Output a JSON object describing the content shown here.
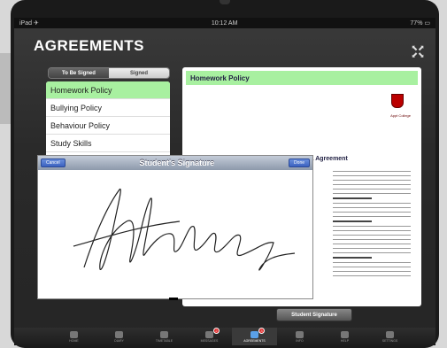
{
  "statusbar": {
    "left": "iPad ✈",
    "time": "10:12 AM",
    "battery": "77% ▭"
  },
  "title": "AGREEMENTS",
  "segment": {
    "to_be_signed": "To Be Signed",
    "signed": "Signed"
  },
  "policies": [
    {
      "label": "Homework Policy",
      "selected": true
    },
    {
      "label": "Bullying Policy",
      "selected": false
    },
    {
      "label": "Behaviour Policy",
      "selected": false
    },
    {
      "label": "Study Skills",
      "selected": false
    }
  ],
  "document": {
    "header": "Homework Policy",
    "college": "Appt College",
    "title": "Homework Policy & Agreement"
  },
  "signature": {
    "cancel": "Cancel",
    "title": "Student's Signature",
    "done": "Done"
  },
  "student_signature_button": "Student Signature",
  "tabs": [
    {
      "label": "HOME",
      "icon": "home-icon",
      "badge": ""
    },
    {
      "label": "DIARY",
      "icon": "diary-icon",
      "badge": ""
    },
    {
      "label": "TIMETABLE",
      "icon": "timetable-icon",
      "badge": ""
    },
    {
      "label": "MESSAGES",
      "icon": "messages-icon",
      "badge": "2"
    },
    {
      "label": "AGREEMENTS",
      "icon": "agreements-icon",
      "badge": "3"
    },
    {
      "label": "INFO",
      "icon": "info-icon",
      "badge": ""
    },
    {
      "label": "HELP",
      "icon": "help-icon",
      "badge": ""
    },
    {
      "label": "SETTINGS",
      "icon": "settings-icon",
      "badge": ""
    }
  ],
  "active_tab": "AGREEMENTS",
  "colors": {
    "selected_green": "#a8f0a0",
    "tab_active": "#5aa0e8"
  }
}
